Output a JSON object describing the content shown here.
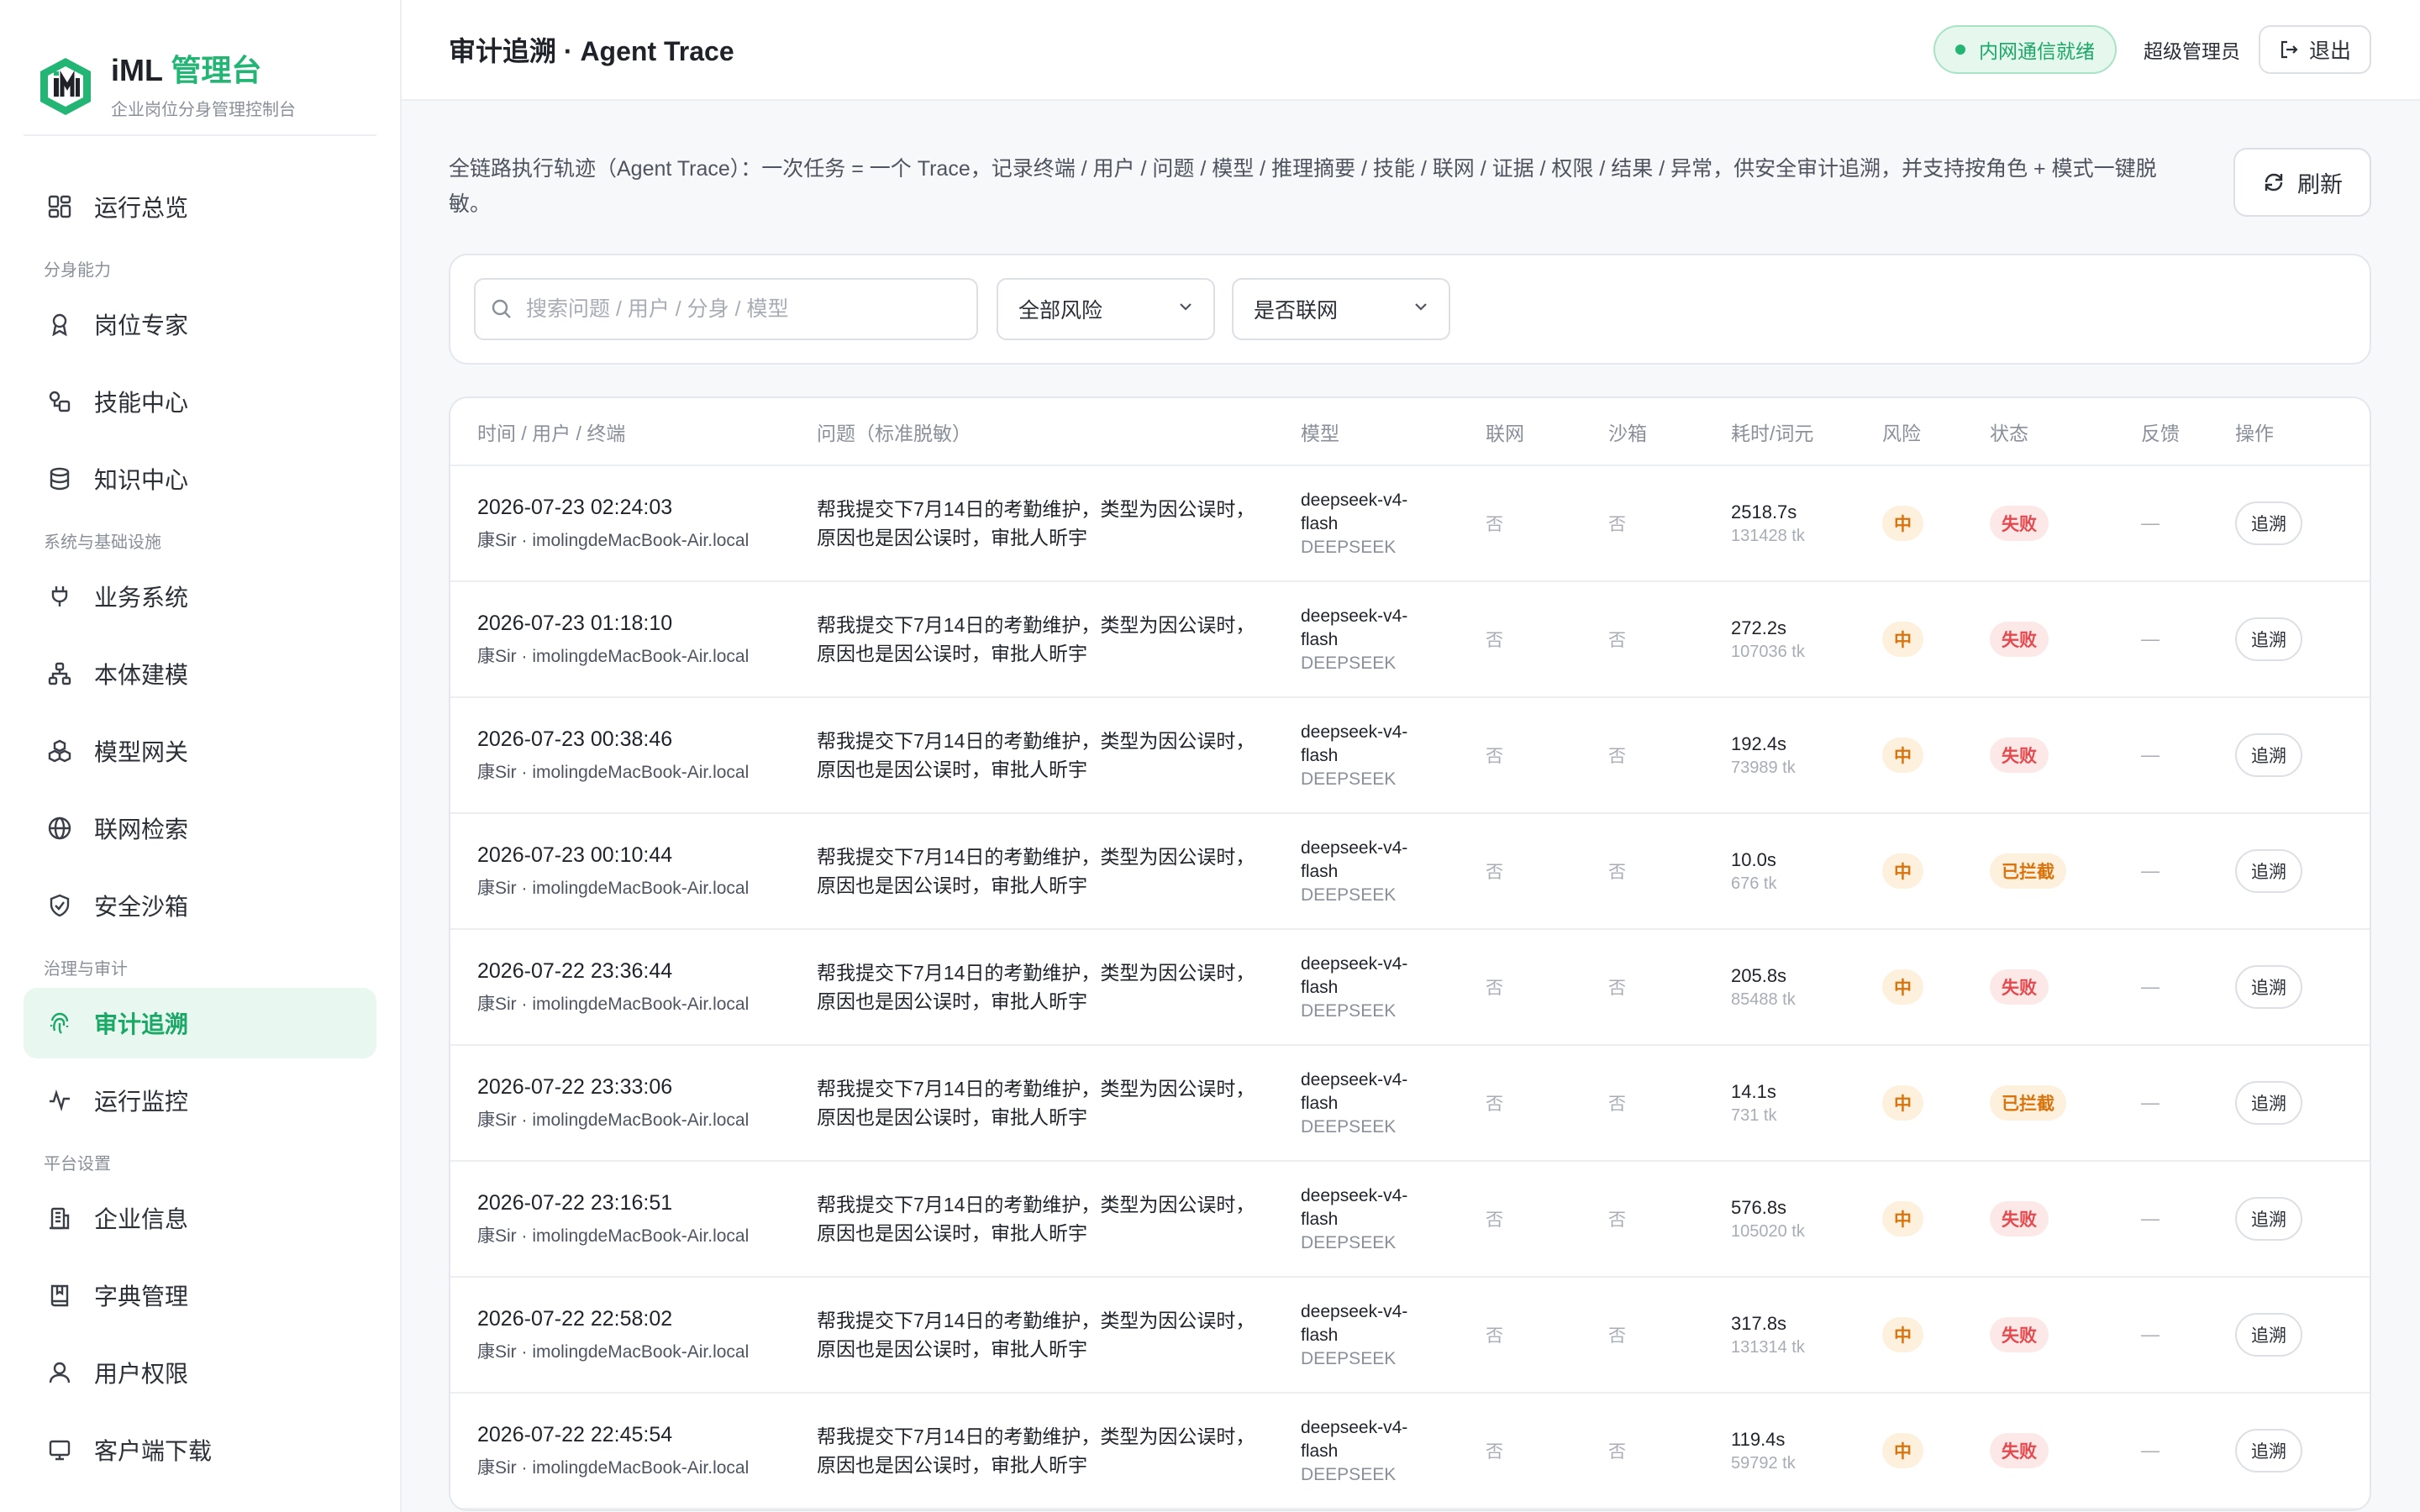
{
  "brand": {
    "title_prefix": "iML",
    "title_accent": "管理台",
    "subtitle": "企业岗位分身管理控制台"
  },
  "colors": {
    "accent": "#22b573",
    "active_bg": "#e8f7ef",
    "fail": "#e5484d",
    "warn": "#d9730d"
  },
  "sidebar": {
    "overview": {
      "label": "运行总览",
      "icon": "dashboard-grid-icon"
    },
    "sections": [
      {
        "label": "分身能力",
        "items": [
          {
            "label": "岗位专家",
            "icon": "expert-icon"
          },
          {
            "label": "技能中心",
            "icon": "skills-icon"
          },
          {
            "label": "知识中心",
            "icon": "database-icon"
          }
        ]
      },
      {
        "label": "系统与基础设施",
        "items": [
          {
            "label": "业务系统",
            "icon": "plug-icon"
          },
          {
            "label": "本体建模",
            "icon": "hierarchy-icon"
          },
          {
            "label": "模型网关",
            "icon": "cubes-icon"
          },
          {
            "label": "联网检索",
            "icon": "globe-icon"
          },
          {
            "label": "安全沙箱",
            "icon": "shield-icon"
          }
        ]
      },
      {
        "label": "治理与审计",
        "items": [
          {
            "label": "审计追溯",
            "icon": "fingerprint-icon",
            "active": true
          },
          {
            "label": "运行监控",
            "icon": "activity-icon"
          }
        ]
      },
      {
        "label": "平台设置",
        "items": [
          {
            "label": "企业信息",
            "icon": "building-icon"
          },
          {
            "label": "字典管理",
            "icon": "book-icon"
          },
          {
            "label": "用户权限",
            "icon": "user-icon"
          },
          {
            "label": "客户端下载",
            "icon": "download-icon"
          }
        ]
      }
    ]
  },
  "header": {
    "title": "审计追溯 · Agent Trace",
    "status": "内网通信就绪",
    "admin": "超级管理员",
    "logout": "退出"
  },
  "description": "全链路执行轨迹（Agent Trace）：一次任务 = 一个 Trace，记录终端 / 用户 / 问题 / 模型 / 推理摘要 / 技能 / 联网 / 证据 / 权限 / 结果 / 异常，供安全审计追溯，并支持按角色 + 模式一键脱敏。",
  "refresh_label": "刷新",
  "filters": {
    "search_placeholder": "搜索问题 / 用户 / 分身 / 模型",
    "risk_value": "全部风险",
    "net_value": "是否联网"
  },
  "table": {
    "columns": [
      "时间 / 用户 / 终端",
      "问题（标准脱敏）",
      "模型",
      "联网",
      "沙箱",
      "耗时/词元",
      "风险",
      "状态",
      "反馈",
      "操作"
    ],
    "rows": [
      {
        "time": "2026-07-23 02:24:03",
        "user": "康Sir · imolingdeMacBook-Air.local",
        "question": "帮我提交下7月14日的考勤维护，类型为因公误时，原因也是因公误时，审批人昕宇",
        "model_line1": "deepseek-v4-",
        "model_line2": "flash",
        "provider": "DEEPSEEK",
        "net": "否",
        "sandbox": "否",
        "duration": "2518.7s",
        "tokens": "131428 tk",
        "risk": "中",
        "status": "失败",
        "status_type": "fail",
        "feedback": "—",
        "action": "追溯"
      },
      {
        "time": "2026-07-23 01:18:10",
        "user": "康Sir · imolingdeMacBook-Air.local",
        "question": "帮我提交下7月14日的考勤维护，类型为因公误时，原因也是因公误时，审批人昕宇",
        "model_line1": "deepseek-v4-",
        "model_line2": "flash",
        "provider": "DEEPSEEK",
        "net": "否",
        "sandbox": "否",
        "duration": "272.2s",
        "tokens": "107036 tk",
        "risk": "中",
        "status": "失败",
        "status_type": "fail",
        "feedback": "—",
        "action": "追溯"
      },
      {
        "time": "2026-07-23 00:38:46",
        "user": "康Sir · imolingdeMacBook-Air.local",
        "question": "帮我提交下7月14日的考勤维护，类型为因公误时，原因也是因公误时，审批人昕宇",
        "model_line1": "deepseek-v4-",
        "model_line2": "flash",
        "provider": "DEEPSEEK",
        "net": "否",
        "sandbox": "否",
        "duration": "192.4s",
        "tokens": "73989 tk",
        "risk": "中",
        "status": "失败",
        "status_type": "fail",
        "feedback": "—",
        "action": "追溯"
      },
      {
        "time": "2026-07-23 00:10:44",
        "user": "康Sir · imolingdeMacBook-Air.local",
        "question": "帮我提交下7月14日的考勤维护，类型为因公误时，原因也是因公误时，审批人昕宇",
        "model_line1": "deepseek-v4-",
        "model_line2": "flash",
        "provider": "DEEPSEEK",
        "net": "否",
        "sandbox": "否",
        "duration": "10.0s",
        "tokens": "676 tk",
        "risk": "中",
        "status": "已拦截",
        "status_type": "block",
        "feedback": "—",
        "action": "追溯"
      },
      {
        "time": "2026-07-22 23:36:44",
        "user": "康Sir · imolingdeMacBook-Air.local",
        "question": "帮我提交下7月14日的考勤维护，类型为因公误时，原因也是因公误时，审批人昕宇",
        "model_line1": "deepseek-v4-",
        "model_line2": "flash",
        "provider": "DEEPSEEK",
        "net": "否",
        "sandbox": "否",
        "duration": "205.8s",
        "tokens": "85488 tk",
        "risk": "中",
        "status": "失败",
        "status_type": "fail",
        "feedback": "—",
        "action": "追溯"
      },
      {
        "time": "2026-07-22 23:33:06",
        "user": "康Sir · imolingdeMacBook-Air.local",
        "question": "帮我提交下7月14日的考勤维护，类型为因公误时，原因也是因公误时，审批人昕宇",
        "model_line1": "deepseek-v4-",
        "model_line2": "flash",
        "provider": "DEEPSEEK",
        "net": "否",
        "sandbox": "否",
        "duration": "14.1s",
        "tokens": "731 tk",
        "risk": "中",
        "status": "已拦截",
        "status_type": "block",
        "feedback": "—",
        "action": "追溯"
      },
      {
        "time": "2026-07-22 23:16:51",
        "user": "康Sir · imolingdeMacBook-Air.local",
        "question": "帮我提交下7月14日的考勤维护，类型为因公误时，原因也是因公误时，审批人昕宇",
        "model_line1": "deepseek-v4-",
        "model_line2": "flash",
        "provider": "DEEPSEEK",
        "net": "否",
        "sandbox": "否",
        "duration": "576.8s",
        "tokens": "105020 tk",
        "risk": "中",
        "status": "失败",
        "status_type": "fail",
        "feedback": "—",
        "action": "追溯"
      },
      {
        "time": "2026-07-22 22:58:02",
        "user": "康Sir · imolingdeMacBook-Air.local",
        "question": "帮我提交下7月14日的考勤维护，类型为因公误时，原因也是因公误时，审批人昕宇",
        "model_line1": "deepseek-v4-",
        "model_line2": "flash",
        "provider": "DEEPSEEK",
        "net": "否",
        "sandbox": "否",
        "duration": "317.8s",
        "tokens": "131314 tk",
        "risk": "中",
        "status": "失败",
        "status_type": "fail",
        "feedback": "—",
        "action": "追溯"
      },
      {
        "time": "2026-07-22 22:45:54",
        "user": "康Sir · imolingdeMacBook-Air.local",
        "question": "帮我提交下7月14日的考勤维护，类型为因公误时，原因也是因公误时，审批人昕宇",
        "model_line1": "deepseek-v4-",
        "model_line2": "flash",
        "provider": "DEEPSEEK",
        "net": "否",
        "sandbox": "否",
        "duration": "119.4s",
        "tokens": "59792 tk",
        "risk": "中",
        "status": "失败",
        "status_type": "fail",
        "feedback": "—",
        "action": "追溯"
      }
    ]
  }
}
